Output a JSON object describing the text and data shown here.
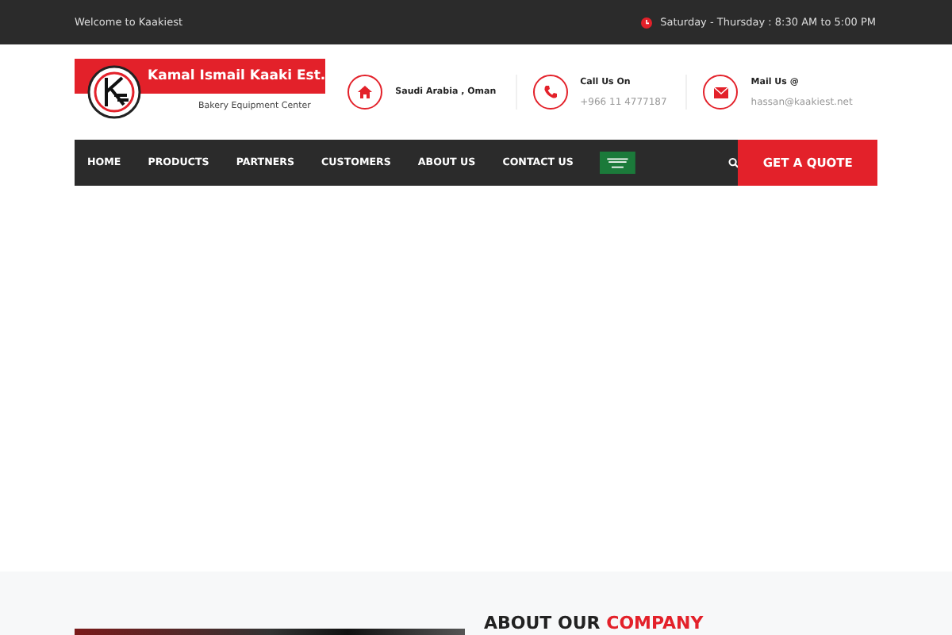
{
  "top_bar": {
    "welcome": "Welcome to Kaakiest",
    "hours": "Saturday - Thursday : 8:30 AM to 5:00 PM"
  },
  "logo": {
    "name": "Kamal Ismail Kaaki Est.",
    "tagline": "Bakery Equipment Center"
  },
  "contacts": [
    {
      "kind": "location",
      "title": "Saudi Arabia , Oman"
    },
    {
      "kind": "phone",
      "title": "Call Us On",
      "detail": "+966 11 4777187"
    },
    {
      "kind": "mail",
      "title": "Mail Us @",
      "detail": "hassan@kaakiest.net"
    }
  ],
  "nav": {
    "items": [
      "HOME",
      "PRODUCTS",
      "PARTNERS",
      "CUSTOMERS",
      "ABOUT US",
      "CONTACT US"
    ],
    "quote_button": "GET A QUOTE"
  },
  "about": {
    "heading": "ABOUT OUR",
    "heading_highlight": "COMPANY"
  }
}
